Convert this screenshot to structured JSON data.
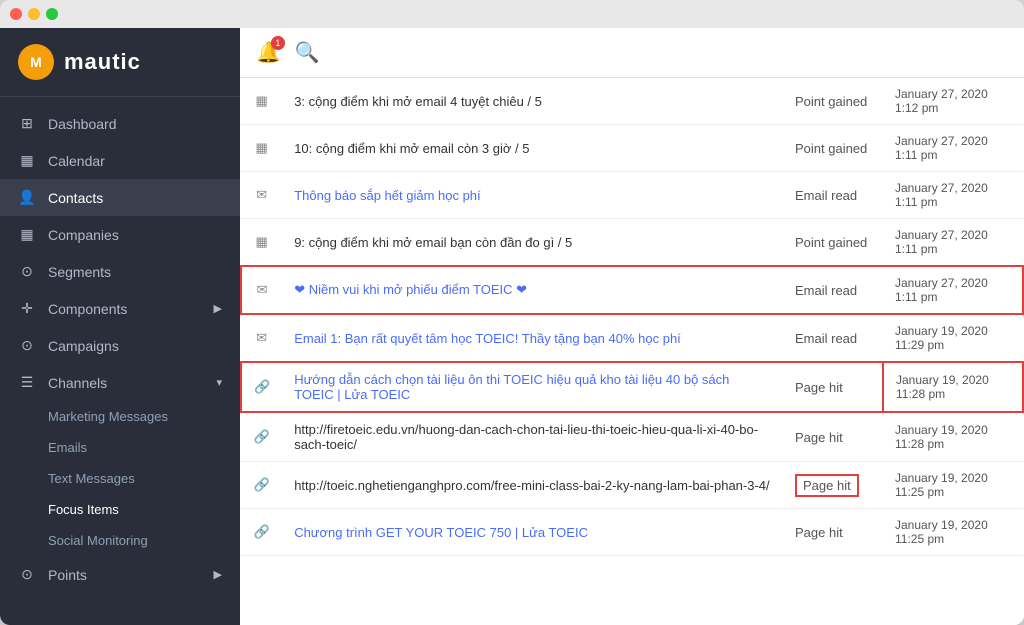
{
  "window": {
    "titlebar": {
      "dots": [
        "red",
        "yellow",
        "green"
      ]
    }
  },
  "sidebar": {
    "logo": {
      "icon": "M",
      "text": "mautic"
    },
    "nav_items": [
      {
        "id": "dashboard",
        "label": "Dashboard",
        "icon": "▦",
        "has_arrow": false,
        "active": false
      },
      {
        "id": "calendar",
        "label": "Calendar",
        "icon": "▦",
        "has_arrow": false,
        "active": false
      },
      {
        "id": "contacts",
        "label": "Contacts",
        "icon": "👤",
        "has_arrow": false,
        "active": true
      },
      {
        "id": "companies",
        "label": "Companies",
        "icon": "▦",
        "has_arrow": false,
        "active": false
      },
      {
        "id": "segments",
        "label": "Segments",
        "icon": "⊙",
        "has_arrow": false,
        "active": false
      },
      {
        "id": "components",
        "label": "Components",
        "icon": "✛",
        "has_arrow": true,
        "active": false
      },
      {
        "id": "campaigns",
        "label": "Campaigns",
        "icon": "⊙",
        "has_arrow": false,
        "active": false
      },
      {
        "id": "channels",
        "label": "Channels",
        "icon": "☰",
        "has_arrow": true,
        "active": false
      }
    ],
    "sub_items": [
      {
        "id": "marketing-messages",
        "label": "Marketing Messages",
        "highlighted": false
      },
      {
        "id": "emails",
        "label": "Emails",
        "highlighted": false
      },
      {
        "id": "text-messages",
        "label": "Text Messages",
        "highlighted": false
      },
      {
        "id": "focus-items",
        "label": "Focus Items",
        "highlighted": true
      },
      {
        "id": "social-monitoring",
        "label": "Social Monitoring",
        "highlighted": false
      }
    ],
    "bottom_items": [
      {
        "id": "points",
        "label": "Points",
        "icon": "⊙",
        "has_arrow": true
      }
    ]
  },
  "topbar": {
    "bell_badge": "1",
    "search_placeholder": "Search"
  },
  "table": {
    "rows": [
      {
        "icon": "▦",
        "text": "3: cộng điểm khi mở email 4 tuyệt chiêu / 5",
        "is_link": false,
        "type": "Point gained",
        "date": "January 27, 2020",
        "time": "1:12 pm",
        "highlight_row": false,
        "highlight_type": false
      },
      {
        "icon": "▦",
        "text": "10: cộng điểm khi mở email còn 3 giờ / 5",
        "is_link": false,
        "type": "Point gained",
        "date": "January 27, 2020",
        "time": "1:11 pm",
        "highlight_row": false,
        "highlight_type": false
      },
      {
        "icon": "✉",
        "text": "Thông báo sắp hết giảm học phí",
        "is_link": true,
        "type": "Email read",
        "date": "January 27, 2020",
        "time": "1:11 pm",
        "highlight_row": false,
        "highlight_type": false
      },
      {
        "icon": "▦",
        "text": "9: cộng điểm khi mở email bạn còn đần đo gì / 5",
        "is_link": false,
        "type": "Point gained",
        "date": "January 27, 2020",
        "time": "1:11 pm",
        "highlight_row": false,
        "highlight_type": false
      },
      {
        "icon": "✉",
        "text": "❤ Niềm vui khi mở phiếu điểm TOEIC ❤",
        "is_link": true,
        "type": "Email read",
        "date": "January 27, 2020",
        "time": "1:11 pm",
        "highlight_row": true,
        "highlight_type": false
      },
      {
        "icon": "✉",
        "text": "Email 1: Bạn rất quyết tâm học TOEIC! Thầy tặng bạn 40% học phí",
        "is_link": true,
        "type": "Email read",
        "date": "January 19, 2020",
        "time": "11:29 pm",
        "highlight_row": false,
        "highlight_type": false
      },
      {
        "icon": "🔗",
        "text": "Hướng dẫn cách chọn tài liệu ôn thi TOEIC hiệu quả kho tài liệu 40 bộ sách TOEIC | Lửa TOEIC",
        "is_link": true,
        "type": "Page hit",
        "date": "January 19, 2020",
        "time": "11:28 pm",
        "highlight_row": true,
        "highlight_type": false
      },
      {
        "icon": "🔗",
        "text": "http://firetoeic.edu.vn/huong-dan-cach-chon-tai-lieu-thi-toeic-hieu-qua-li-xi-40-bo-sach-toeic/",
        "is_link": false,
        "type": "Page hit",
        "date": "January 19, 2020",
        "time": "11:28 pm",
        "highlight_row": false,
        "highlight_type": false
      },
      {
        "icon": "🔗",
        "text": "http://toeic.nghetienganghpro.com/free-mini-class-bai-2-ky-nang-lam-bai-phan-3-4/",
        "is_link": false,
        "type": "Page hit",
        "date": "January 19, 2020",
        "time": "11:25 pm",
        "highlight_row": false,
        "highlight_type": true
      },
      {
        "icon": "🔗",
        "text": "Chương trình GET YOUR TOEIC 750 | Lửa TOEIC",
        "is_link": true,
        "type": "Page hit",
        "date": "January 19, 2020",
        "time": "11:25 pm",
        "highlight_row": false,
        "highlight_type": false
      }
    ]
  }
}
